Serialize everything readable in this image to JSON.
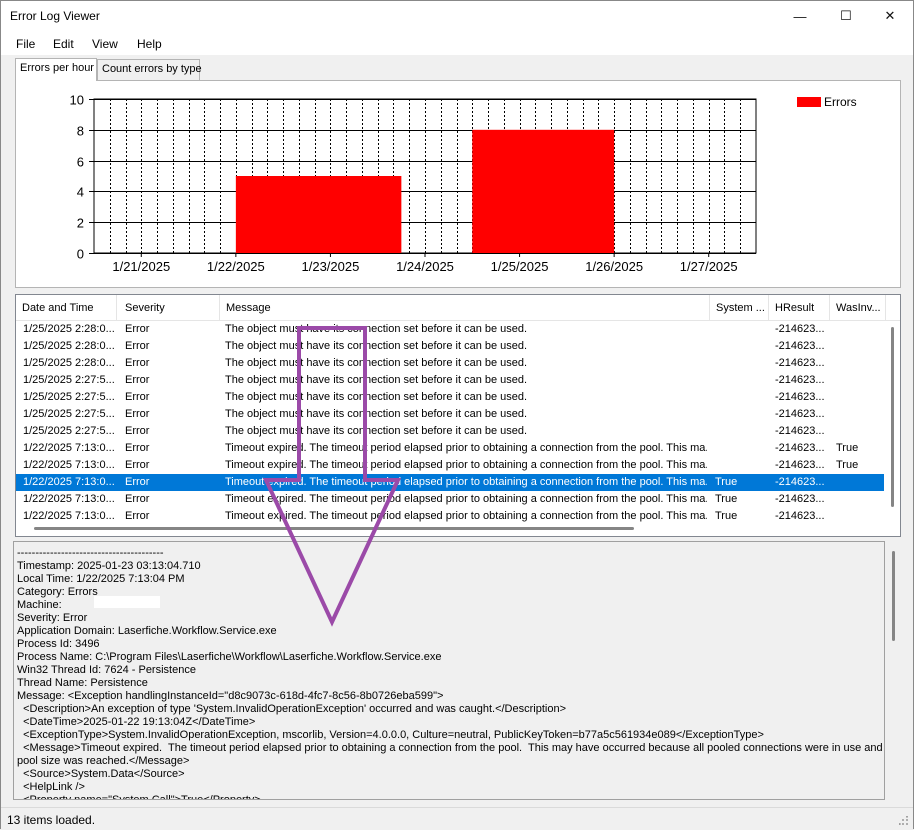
{
  "window": {
    "title": "Error Log Viewer",
    "minimize_glyph": "—",
    "maximize_glyph": "☐",
    "close_glyph": "✕"
  },
  "menus": [
    {
      "label": "File"
    },
    {
      "label": "Edit"
    },
    {
      "label": "View"
    },
    {
      "label": "Help"
    }
  ],
  "tabs": [
    {
      "label": "Errors per hour",
      "active": true
    },
    {
      "label": "Count errors by type",
      "active": false
    }
  ],
  "chart_data": {
    "type": "bar",
    "series": [
      {
        "name": "Errors",
        "color": "#ff0000",
        "bars": [
          {
            "start": "2025-01-22",
            "end": "2025-01-23T18:00",
            "value": 5
          },
          {
            "start": "2025-01-24T12:00",
            "end": "2025-01-26",
            "value": 8
          }
        ]
      }
    ],
    "x_tick_labels": [
      "1/21/2025",
      "1/22/2025",
      "1/23/2025",
      "1/24/2025",
      "1/25/2025",
      "1/26/2025",
      "1/27/2025"
    ],
    "y_tick_labels": [
      "0",
      "2",
      "4",
      "6",
      "8",
      "10"
    ],
    "ylim": [
      0,
      10
    ],
    "grid": "vertical dashed lines every 4 hours, horizontal lines at each y tick",
    "legend": "top-right"
  },
  "grid": {
    "columns": [
      "Date and Time",
      "Severity",
      "Message",
      "System ...",
      "HResult",
      "WasInv..."
    ],
    "rows": [
      {
        "datetime": "1/25/2025 2:28:0...",
        "severity": "Error",
        "message": "The object must have its connection set before it can be used.",
        "system": "",
        "hresult": "-214623...",
        "wasinv": ""
      },
      {
        "datetime": "1/25/2025 2:28:0...",
        "severity": "Error",
        "message": "The object must have its connection set before it can be used.",
        "system": "",
        "hresult": "-214623...",
        "wasinv": ""
      },
      {
        "datetime": "1/25/2025 2:28:0...",
        "severity": "Error",
        "message": "The object must have its connection set before it can be used.",
        "system": "",
        "hresult": "-214623...",
        "wasinv": ""
      },
      {
        "datetime": "1/25/2025 2:27:5...",
        "severity": "Error",
        "message": "The object must have its connection set before it can be used.",
        "system": "",
        "hresult": "-214623...",
        "wasinv": ""
      },
      {
        "datetime": "1/25/2025 2:27:5...",
        "severity": "Error",
        "message": "The object must have its connection set before it can be used.",
        "system": "",
        "hresult": "-214623...",
        "wasinv": ""
      },
      {
        "datetime": "1/25/2025 2:27:5...",
        "severity": "Error",
        "message": "The object must have its connection set before it can be used.",
        "system": "",
        "hresult": "-214623...",
        "wasinv": ""
      },
      {
        "datetime": "1/25/2025 2:27:5...",
        "severity": "Error",
        "message": "The object must have its connection set before it can be used.",
        "system": "",
        "hresult": "-214623...",
        "wasinv": ""
      },
      {
        "datetime": "1/22/2025 7:13:0...",
        "severity": "Error",
        "message": "Timeout expired.  The timeout period elapsed prior to obtaining a connection from the pool.  This ma...",
        "system": "",
        "hresult": "-214623...",
        "wasinv": "True"
      },
      {
        "datetime": "1/22/2025 7:13:0...",
        "severity": "Error",
        "message": "Timeout expired.  The timeout period elapsed prior to obtaining a connection from the pool.  This ma...",
        "system": "",
        "hresult": "-214623...",
        "wasinv": "True"
      },
      {
        "datetime": "1/22/2025 7:13:0...",
        "severity": "Error",
        "message": "Timeout expired.  The timeout period elapsed prior to obtaining a connection from the pool.  This ma...",
        "system": "True",
        "hresult": "-214623...",
        "wasinv": "",
        "selected": true
      },
      {
        "datetime": "1/22/2025 7:13:0...",
        "severity": "Error",
        "message": "Timeout expired.  The timeout period elapsed prior to obtaining a connection from the pool.  This ma...",
        "system": "True",
        "hresult": "-214623...",
        "wasinv": ""
      },
      {
        "datetime": "1/22/2025 7:13:0...",
        "severity": "Error",
        "message": "Timeout expired.  The timeout period elapsed prior to obtaining a connection from the pool.  This ma...",
        "system": "True",
        "hresult": "-214623...",
        "wasinv": ""
      }
    ]
  },
  "detail": {
    "lines": [
      "----------------------------------------",
      "Timestamp: 2025-01-23 03:13:04.710",
      "Local Time: 1/22/2025 7:13:04 PM",
      "Category: Errors",
      "Machine:",
      "Severity: Error",
      "Application Domain: Laserfiche.Workflow.Service.exe",
      "Process Id: 3496",
      "Process Name: C:\\Program Files\\Laserfiche\\Workflow\\Laserfiche.Workflow.Service.exe",
      "Win32 Thread Id: 7624 - Persistence",
      "Thread Name: Persistence",
      "Message: <Exception handlingInstanceId=\"d8c9073c-618d-4fc7-8c56-8b0726eba599\">",
      "  <Description>An exception of type 'System.InvalidOperationException' occurred and was caught.</Description>",
      "  <DateTime>2025-01-22 19:13:04Z</DateTime>",
      "  <ExceptionType>System.InvalidOperationException, mscorlib, Version=4.0.0.0, Culture=neutral, PublicKeyToken=b77a5c561934e089</ExceptionType>",
      "  <Message>Timeout expired.  The timeout period elapsed prior to obtaining a connection from the pool.  This may have occurred because all pooled connections were in use and max",
      "pool size was reached.</Message>",
      "  <Source>System.Data</Source>",
      "  <HelpLink />",
      "  <Property name=\"System.Call\">True</Property>"
    ]
  },
  "status": {
    "text": "13 items loaded."
  },
  "colors": {
    "selection": "#0078d7",
    "bar": "#ff0000",
    "annotation": "#9b4aa8"
  },
  "icons": [
    "minimize-icon",
    "maximize-icon",
    "close-icon",
    "resize-grip-icon"
  ]
}
